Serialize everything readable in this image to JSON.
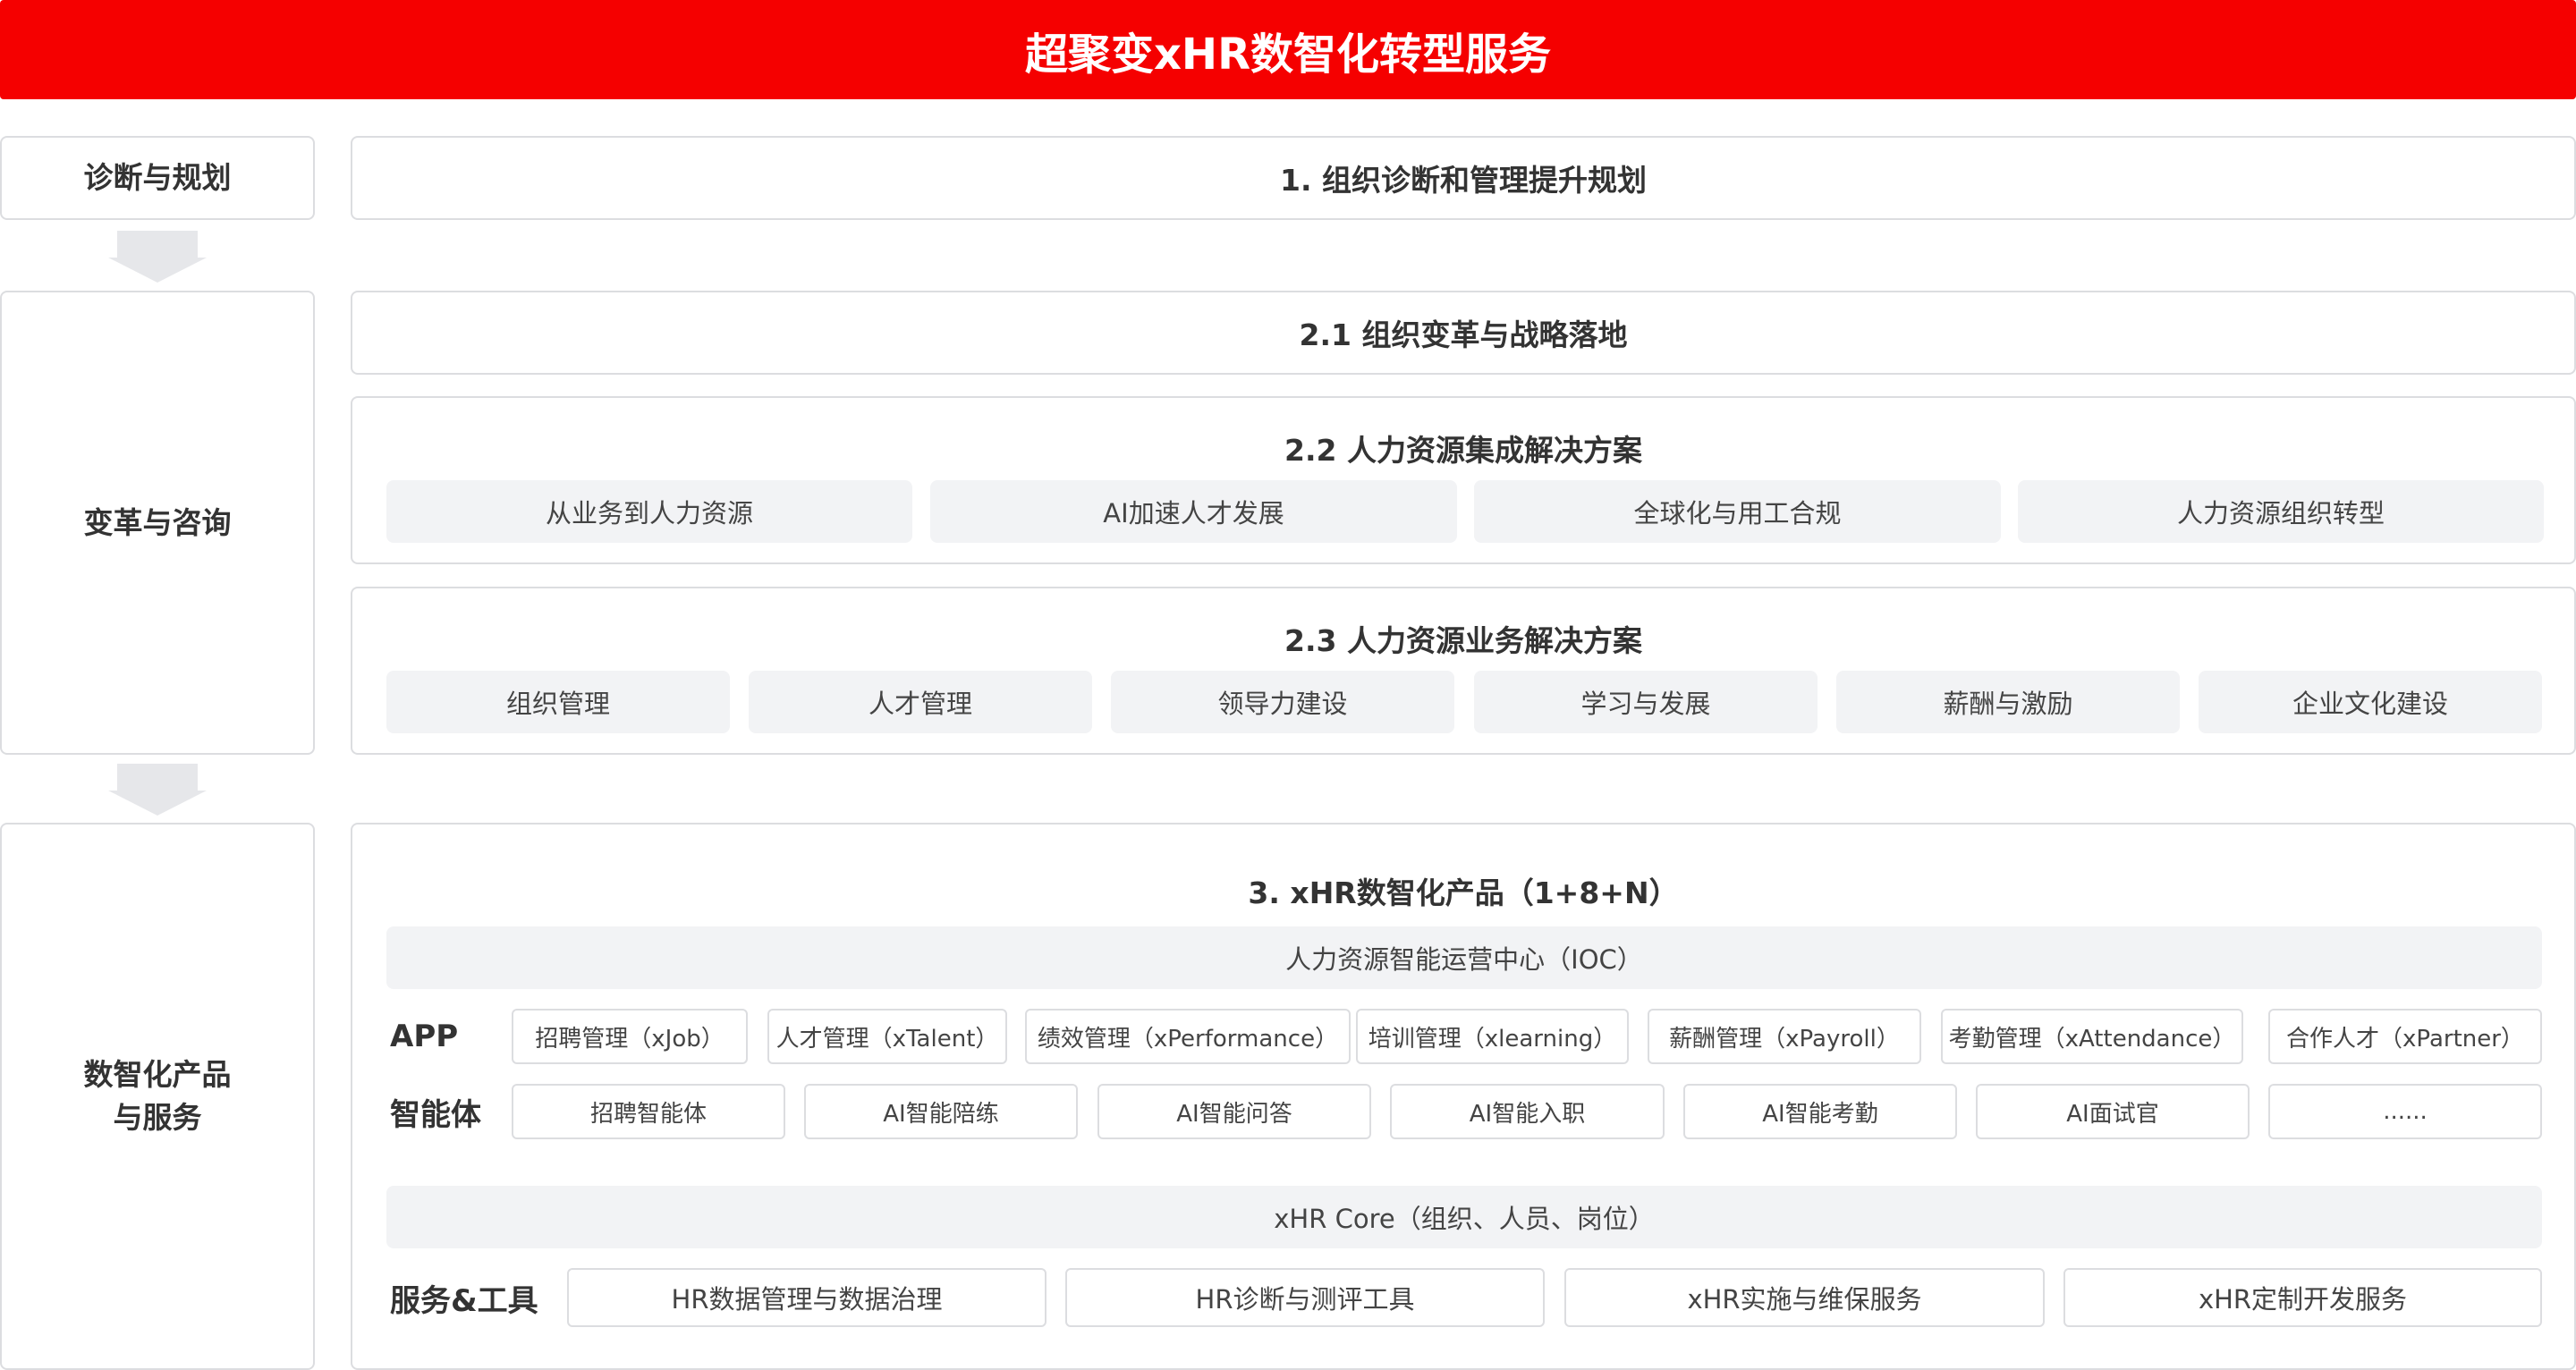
{
  "title": "超聚变xHR数智化转型服务",
  "left": {
    "diagnosis": "诊断与规划",
    "transform": "变革与咨询",
    "digital_line1": "数智化产品",
    "digital_line2": "与服务"
  },
  "section1": {
    "title": "1. 组织诊断和管理提升规划"
  },
  "section21": {
    "title": "2.1 组织变革与战略落地"
  },
  "section22": {
    "title": "2.2 人力资源集成解决方案",
    "items": [
      "从业务到人力资源",
      "AI加速人才发展",
      "全球化与用工合规",
      "人力资源组织转型"
    ]
  },
  "section23": {
    "title": "2.3 人力资源业务解决方案",
    "items": [
      "组织管理",
      "人才管理",
      "领导力建设",
      "学习与发展",
      "薪酬与激励",
      "企业文化建设"
    ]
  },
  "section3": {
    "title": "3. xHR数智化产品（1+8+N）",
    "ioc": "人力资源智能运营中心（IOC）",
    "app_label": "APP",
    "apps": [
      "招聘管理（xJob）",
      "人才管理（xTalent）",
      "绩效管理（xPerformance）",
      "培训管理（xlearning）",
      "薪酬管理（xPayroll）",
      "考勤管理（xAttendance）",
      "合作人才（xPartner）"
    ],
    "agent_label": "智能体",
    "agents": [
      "招聘智能体",
      "AI智能陪练",
      "AI智能问答",
      "AI智能入职",
      "AI智能考勤",
      "AI面试官",
      "......"
    ],
    "core": "xHR Core（组织、人员、岗位）",
    "services_label": "服务&工具",
    "services": [
      "HR数据管理与数据治理",
      "HR诊断与测评工具",
      "xHR实施与维保服务",
      "xHR定制开发服务"
    ]
  },
  "colors": {
    "banner": "#f50000",
    "border": "#dcdde0",
    "chip": "#f2f3f5",
    "arrow": "#e6e7ea"
  }
}
